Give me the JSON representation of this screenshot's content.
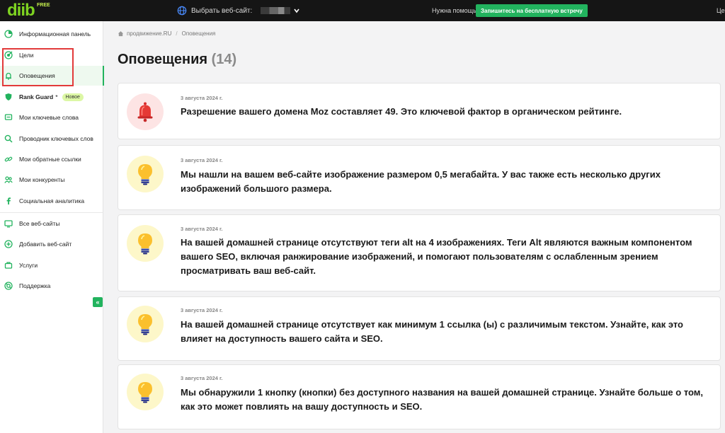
{
  "topbar": {
    "logo": "diib",
    "logo_tag": "FREE",
    "site_label": "Выбрать веб-сайт:",
    "help_text": "Нужна помощь?",
    "cta_label": "Запишитесь на бесплатную встречу",
    "cut_text": "Це"
  },
  "sidebar": {
    "items": [
      {
        "label": "Информационная панель",
        "icon": "dashboard-icon"
      },
      {
        "label": "Цели",
        "icon": "target-icon"
      },
      {
        "label": "Оповещения",
        "icon": "bell-icon"
      },
      {
        "label": "Rank Guard",
        "icon": "shield-icon",
        "badge": "Новое",
        "suffix": "*"
      },
      {
        "label": "Мои ключевые слова",
        "icon": "keywords-icon"
      },
      {
        "label": "Проводник ключевых слов",
        "icon": "search-icon"
      },
      {
        "label": "Мои обратные ссылки",
        "icon": "link-icon"
      },
      {
        "label": "Мои конкуренты",
        "icon": "users-icon"
      },
      {
        "label": "Социальная аналитика",
        "icon": "facebook-icon"
      },
      {
        "label": "Все веб-сайты",
        "icon": "websites-icon"
      },
      {
        "label": "Добавить веб-сайт",
        "icon": "add-icon"
      },
      {
        "label": "Услуги",
        "icon": "services-icon"
      },
      {
        "label": "Поддержка",
        "icon": "support-icon"
      }
    ],
    "collapse_glyph": "«",
    "accent": "#22b35e",
    "highlight_color": "#e23a3a"
  },
  "breadcrumb": {
    "home": "продвижение.RU",
    "separator": "/",
    "current": "Оповещения"
  },
  "page": {
    "title": "Оповещения",
    "count": "(14)"
  },
  "alerts": [
    {
      "date": "3 августа 2024 г.",
      "icon": "bell-icon",
      "text": "Разрешение вашего домена Moz составляет 49. Это ключевой фактор в органическом рейтинге."
    },
    {
      "date": "3 августа 2024 г.",
      "icon": "lightbulb-icon",
      "text": "Мы нашли на вашем веб-сайте изображение размером 0,5 мегабайта. У вас также есть несколько других изображений большого размера."
    },
    {
      "date": "3 августа 2024 г.",
      "icon": "lightbulb-icon",
      "text": "На вашей домашней странице отсутствуют теги alt на 4 изображениях. Теги Alt являются важным компонентом вашего SEO, включая ранжирование изображений, и помогают пользователям с ослабленным зрением просматривать ваш веб-сайт."
    },
    {
      "date": "3 августа 2024 г.",
      "icon": "lightbulb-icon",
      "text": "На вашей домашней странице отсутствует как минимум 1 ссылка (ы) с различимым текстом. Узнайте, как это влияет на доступность вашего сайта и SEO."
    },
    {
      "date": "3 августа 2024 г.",
      "icon": "lightbulb-icon",
      "text": "Мы обнаружили 1 кнопку (кнопки) без доступного названия на вашей домашней странице. Узнайте больше о том, как это может повлиять на вашу доступность и SEO."
    }
  ]
}
